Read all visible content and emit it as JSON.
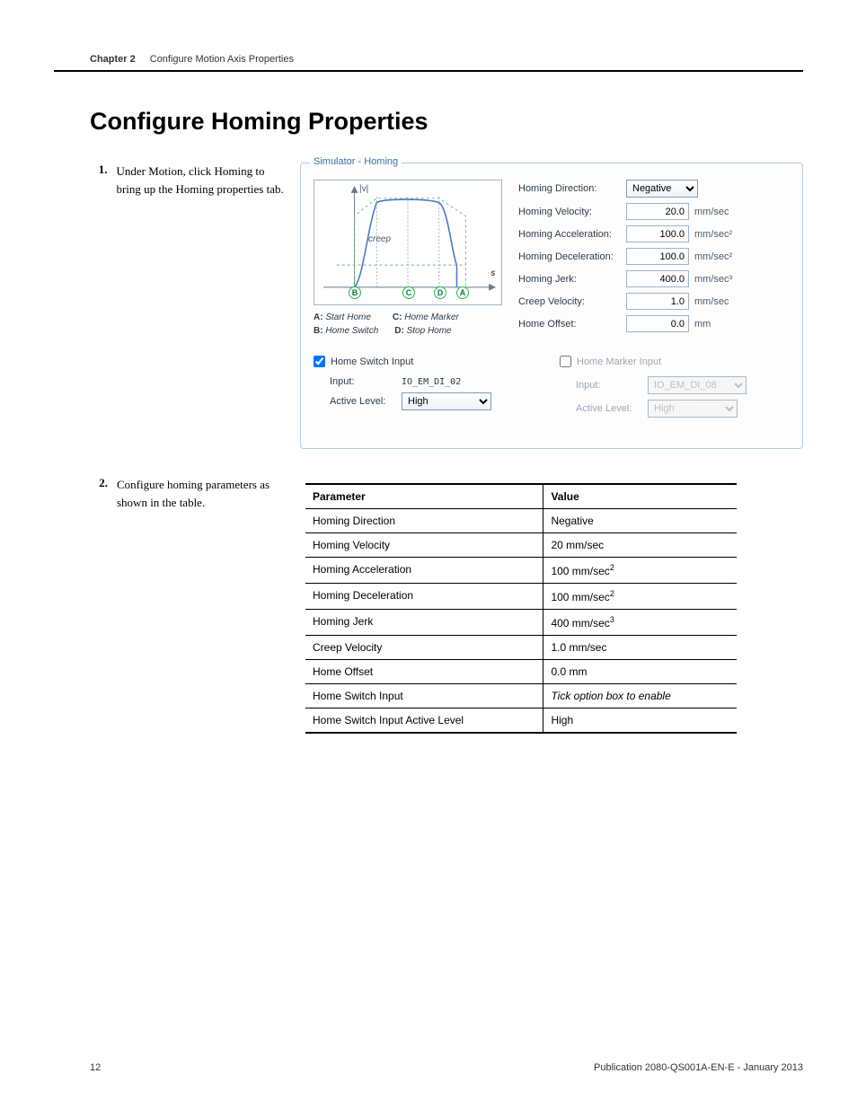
{
  "header": {
    "chapter": "Chapter 2",
    "title": "Configure Motion Axis Properties"
  },
  "section_title": "Configure Homing Properties",
  "steps": {
    "s1": {
      "num": "1.",
      "text": "Under Motion, click Homing to bring up the Homing properties tab."
    },
    "s2": {
      "num": "2.",
      "text": "Configure homing parameters as shown in the table."
    }
  },
  "sim": {
    "legend": "Simulator - Homing",
    "diagram": {
      "v_label": "|v|",
      "creep_label": "creep",
      "s_label": "s",
      "markers": {
        "a": "A",
        "b": "B",
        "c": "C",
        "d": "D"
      },
      "legend_a": "A:",
      "legend_a_v": "Start Home",
      "legend_b": "B:",
      "legend_b_v": "Home Switch",
      "legend_c": "C:",
      "legend_c_v": "Home Marker",
      "legend_d": "D:",
      "legend_d_v": "Stop Home"
    },
    "params": {
      "direction": {
        "label": "Homing Direction:",
        "value": "Negative"
      },
      "velocity": {
        "label": "Homing Velocity:",
        "value": "20.0",
        "unit": "mm/sec"
      },
      "accel": {
        "label": "Homing Acceleration:",
        "value": "100.0",
        "unit": "mm/sec²"
      },
      "decel": {
        "label": "Homing Deceleration:",
        "value": "100.0",
        "unit": "mm/sec²"
      },
      "jerk": {
        "label": "Homing Jerk:",
        "value": "400.0",
        "unit": "mm/sec³"
      },
      "creep": {
        "label": "Creep Velocity:",
        "value": "1.0",
        "unit": "mm/sec"
      },
      "offset": {
        "label": "Home Offset:",
        "value": "0.0",
        "unit": "mm"
      }
    },
    "switch": {
      "title": "Home Switch Input",
      "input_label": "Input:",
      "input_value": "IO_EM_DI_02",
      "level_label": "Active Level:",
      "level_value": "High"
    },
    "marker": {
      "title": "Home Marker Input",
      "input_label": "Input:",
      "input_value": "IO_EM_DI_08",
      "level_label": "Active Level:",
      "level_value": "High"
    }
  },
  "table": {
    "head_param": "Parameter",
    "head_value": "Value",
    "rows": [
      {
        "p": "Homing Direction",
        "v": "Negative"
      },
      {
        "p": "Homing Velocity",
        "v": "20 mm/sec"
      },
      {
        "p": "Homing Acceleration",
        "v": "100 mm/sec",
        "sup": "2"
      },
      {
        "p": "Homing Deceleration",
        "v": "100 mm/sec",
        "sup": "2"
      },
      {
        "p": "Homing Jerk",
        "v": "400 mm/sec",
        "sup": "3"
      },
      {
        "p": "Creep Velocity",
        "v": "1.0 mm/sec"
      },
      {
        "p": "Home Offset",
        "v": "0.0 mm"
      },
      {
        "p": "Home Switch Input",
        "v": "Tick option box to enable",
        "italic": true
      },
      {
        "p": "Home Switch Input Active Level",
        "v": "High"
      }
    ]
  },
  "footer": {
    "page": "12",
    "pub": "Publication 2080-QS001A-EN-E - January 2013"
  }
}
